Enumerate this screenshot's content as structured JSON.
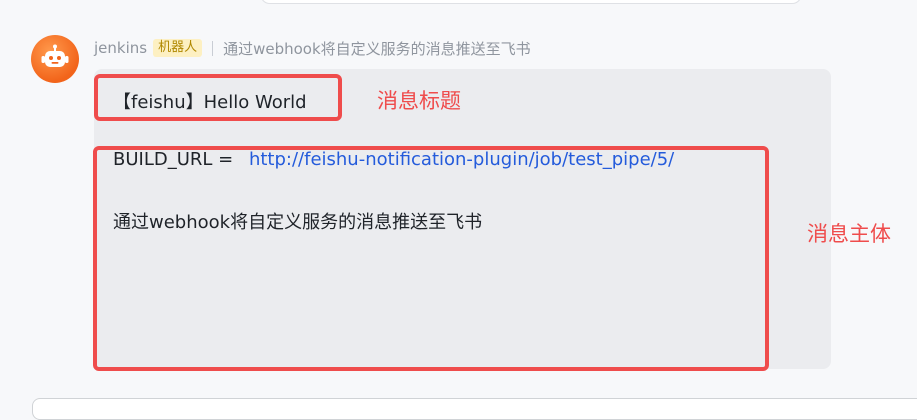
{
  "message": {
    "sender": "jenkins",
    "sender_badge": "机器人",
    "summary": "通过webhook将自定义服务的消息推送至飞书",
    "avatar_icon": "robot-icon",
    "card": {
      "title": "【feishu】Hello World",
      "url_label": "BUILD_URL = ",
      "url": "http://feishu-notification-plugin/job/test_pipe/5/",
      "body_text": "通过webhook将自定义服务的消息推送至飞书"
    }
  },
  "annotations": {
    "title_label": "消息标题",
    "body_label": "消息主体",
    "highlight_color": "#ef4c4c"
  },
  "colors": {
    "link": "#245bdb",
    "badge_bg": "#fdf0c2",
    "badge_text": "#b08800",
    "avatar": "#f2641a"
  }
}
